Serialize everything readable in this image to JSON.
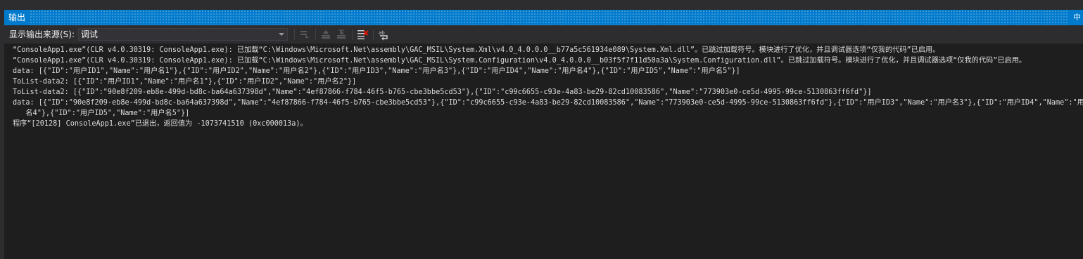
{
  "window": {
    "title": "输出",
    "pin_glyph": "中"
  },
  "toolbar": {
    "source_label": "显示输出来源(S):",
    "source_value": "调试"
  },
  "output": {
    "lines": [
      "“ConsoleApp1.exe”(CLR v4.0.30319: ConsoleApp1.exe): 已加载“C:\\Windows\\Microsoft.Net\\assembly\\GAC_MSIL\\System.Xml\\v4.0_4.0.0.0__b77a5c561934e089\\System.Xml.dll”。已跳过加载符号。模块进行了优化，并且调试器选项“仅我的代码”已启用。",
      "“ConsoleApp1.exe”(CLR v4.0.30319: ConsoleApp1.exe): 已加载“C:\\Windows\\Microsoft.Net\\assembly\\GAC_MSIL\\System.Configuration\\v4.0_4.0.0.0__b03f5f7f11d50a3a\\System.Configuration.dll”。已跳过加载符号。模块进行了优化，并且调试器选项“仅我的代码”已启用。",
      "data: [{\"ID\":\"用户ID1\",\"Name\":\"用户名1\"},{\"ID\":\"用户ID2\",\"Name\":\"用户名2\"},{\"ID\":\"用户ID3\",\"Name\":\"用户名3\"},{\"ID\":\"用户ID4\",\"Name\":\"用户名4\"},{\"ID\":\"用户ID5\",\"Name\":\"用户名5\"}]",
      "ToList-data2: [{\"ID\":\"用户ID1\",\"Name\":\"用户名1\"},{\"ID\":\"用户ID2\",\"Name\":\"用户名2\"}]",
      "ToList-data2: [{\"ID\":\"90e8f209-eb8e-499d-bd8c-ba64a637398d\",\"Name\":\"4ef87866-f784-46f5-b765-cbe3bbe5cd53\"},{\"ID\":\"c99c6655-c93e-4a83-be29-82cd10083586\",\"Name\":\"773903e0-ce5d-4995-99ce-5130863ff6fd\"}]",
      "data: [{\"ID\":\"90e8f209-eb8e-499d-bd8c-ba64a637398d\",\"Name\":\"4ef87866-f784-46f5-b765-cbe3bbe5cd53\"},{\"ID\":\"c99c6655-c93e-4a83-be29-82cd10083586\",\"Name\":\"773903e0-ce5d-4995-99ce-5130863ff6fd\"},{\"ID\":\"用户ID3\",\"Name\":\"用户名3\"},{\"ID\":\"用户ID4\",\"Name\":\"用户",
      "   名4\"},{\"ID\":\"用户ID5\",\"Name\":\"用户名5\"}]",
      "程序“[20128] ConsoleApp1.exe”已退出，返回值为 -1073741510 (0xc000013a)。"
    ]
  },
  "icons": {
    "goto_source": "find-message-icon",
    "prev_message": "previous-message-icon",
    "next_message": "next-message-icon",
    "clear_all": "clear-all-icon",
    "word_wrap": "word-wrap-icon"
  },
  "colors": {
    "accent": "#007acc",
    "background": "#1e1e1e",
    "toolbar": "#2d2d30",
    "text": "#dcdcdc",
    "clear_icon": "#e51400"
  }
}
